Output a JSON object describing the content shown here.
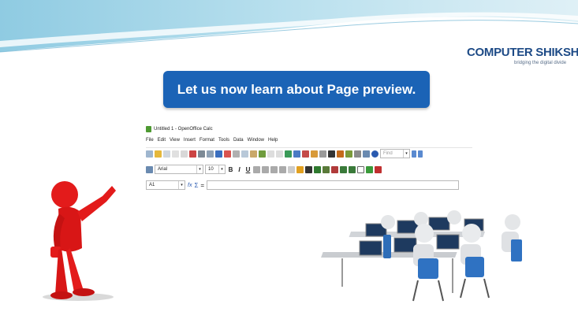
{
  "slide": {
    "heading": "Let us now learn about Page preview."
  },
  "logo": {
    "name": "COMPUTER SHIKSHA",
    "tagline": "bridging the digital divide"
  },
  "calc": {
    "window_title": "Untitled 1 - OpenOffice Calc",
    "menus": [
      "File",
      "Edit",
      "View",
      "Insert",
      "Format",
      "Tools",
      "Data",
      "Window",
      "Help"
    ],
    "find_placeholder": "Find",
    "font_name": "Arial",
    "font_size": "10",
    "bold": "B",
    "italic": "I",
    "underline": "U",
    "cell_ref": "A1",
    "function_symbol": "fx",
    "sum_symbol": "Σ",
    "equals_symbol": "="
  },
  "colors": {
    "banner": "#1b63b6",
    "wave": "#a9d6ea",
    "figure": "#e31b1b"
  }
}
